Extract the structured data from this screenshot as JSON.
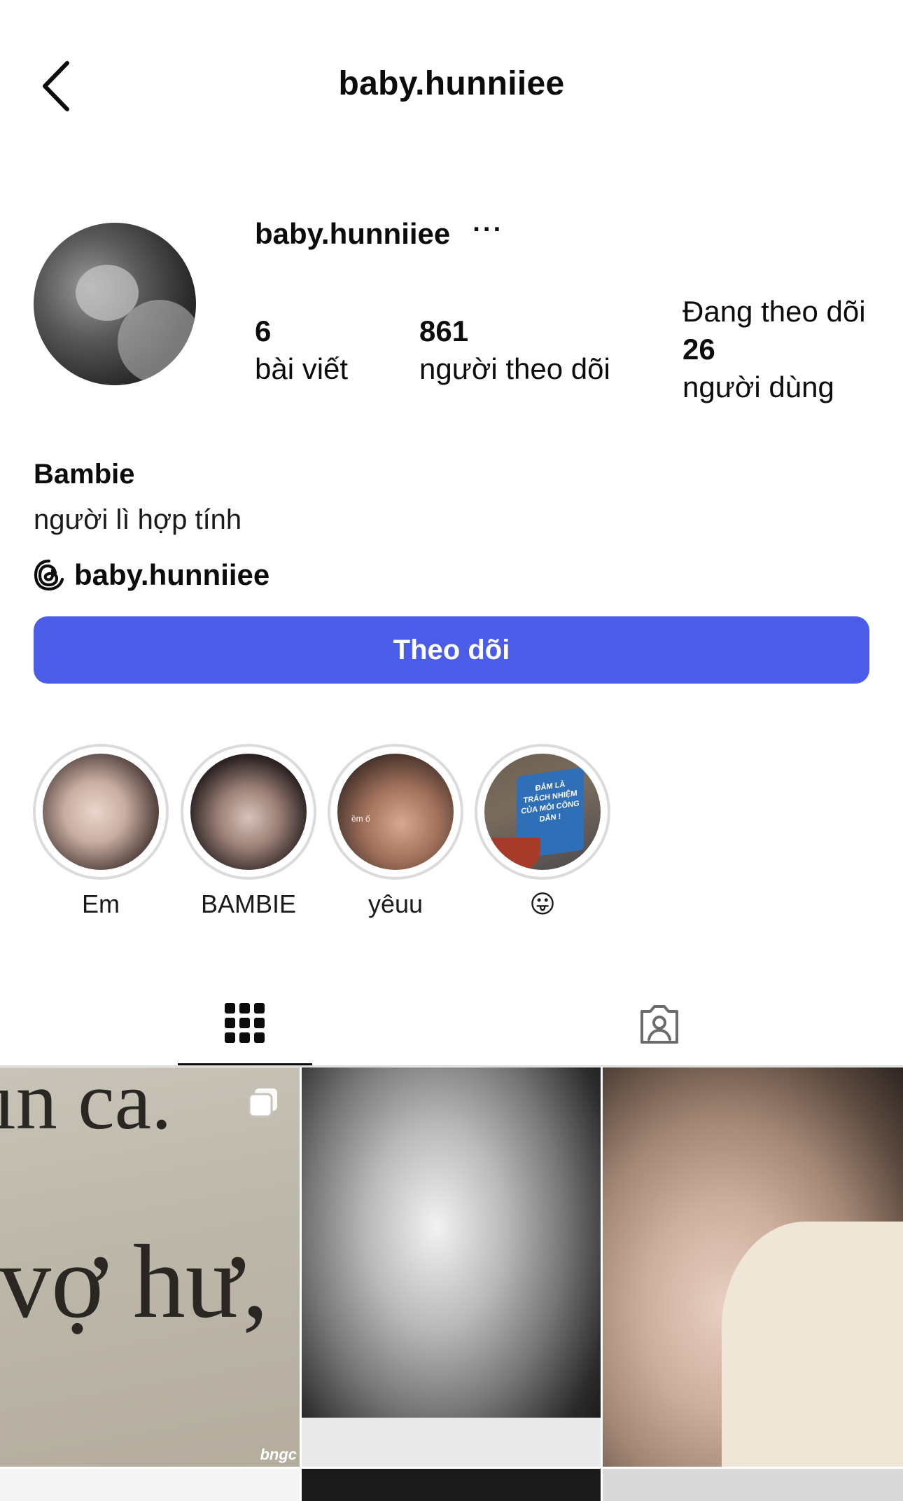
{
  "header": {
    "title": "baby.hunniiee"
  },
  "profile": {
    "username": "baby.hunniiee",
    "more_label": "···",
    "stats": {
      "posts": {
        "value": "6",
        "label": "bài viết"
      },
      "followers": {
        "value": "861",
        "label": "người theo dõi"
      },
      "following": {
        "label_top": "Đang theo dõi",
        "value": "26",
        "label": "người dùng"
      }
    },
    "name": "Bambie",
    "bio": "người lì hợp tính",
    "threads_handle": "baby.hunniiee",
    "follow_button": "Theo dõi"
  },
  "highlights": [
    {
      "label": "Em"
    },
    {
      "label": "BAMBIE"
    },
    {
      "label": "yêuu",
      "overlay_text": "ềm ố"
    },
    {
      "label": "😛",
      "sign_text": "ĐẢM LÀ TRÁCH NHIỆM CỦA MỖI CÔNG DÂN !"
    }
  ],
  "tabs": [
    {
      "name": "posts-grid",
      "icon": "grid-icon",
      "active": true
    },
    {
      "name": "tagged",
      "icon": "tagged-person-icon",
      "active": false
    }
  ],
  "posts": [
    {
      "text_line1": "ın ca.",
      "text_line2": "vợ hư,",
      "watermark": "bngc",
      "multi": true
    },
    {
      "multi": false
    },
    {
      "multi": false
    }
  ],
  "colors": {
    "accent": "#4a5ce8",
    "divider": "#dbdbdb",
    "text": "#0c0c0c"
  }
}
